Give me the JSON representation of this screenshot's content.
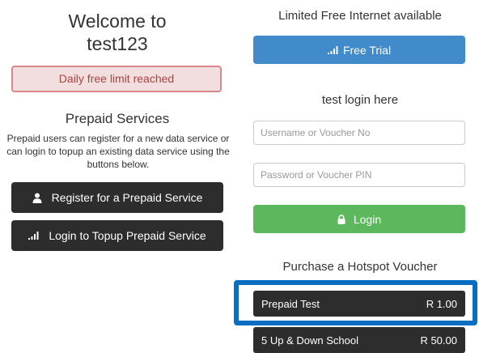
{
  "welcome": {
    "line1": "Welcome to",
    "line2": "test123"
  },
  "alert": {
    "text": "Daily free limit reached"
  },
  "prepaid": {
    "title": "Prepaid Services",
    "description": "Prepaid users can register for a new data service or can login to topup an existing data service using the buttons below.",
    "register_label": "Register for a Prepaid Service",
    "topup_label": "Login to Topup Prepaid Service"
  },
  "free_internet": {
    "title": "Limited Free Internet available",
    "trial_label": "Free Trial"
  },
  "login": {
    "title": "test login here",
    "username_placeholder": "Username or Voucher No",
    "password_placeholder": "Password or Voucher PIN",
    "button_label": "Login"
  },
  "vouchers": {
    "title": "Purchase a Hotspot Voucher",
    "items": [
      {
        "name": "Prepaid Test",
        "price": "R 1.00"
      },
      {
        "name": "5 Up & Down School",
        "price": "R 50.00"
      }
    ]
  },
  "colors": {
    "primary": "#428bca",
    "success": "#5cb85c",
    "dark": "#2d2d2d",
    "alert_bg": "#f2dede",
    "alert_text": "#a94442",
    "highlight": "#0a6ec0"
  },
  "icons": {
    "register": "user-icon",
    "topup": "signal-icon",
    "trial": "signal-icon",
    "login": "lock-icon"
  }
}
